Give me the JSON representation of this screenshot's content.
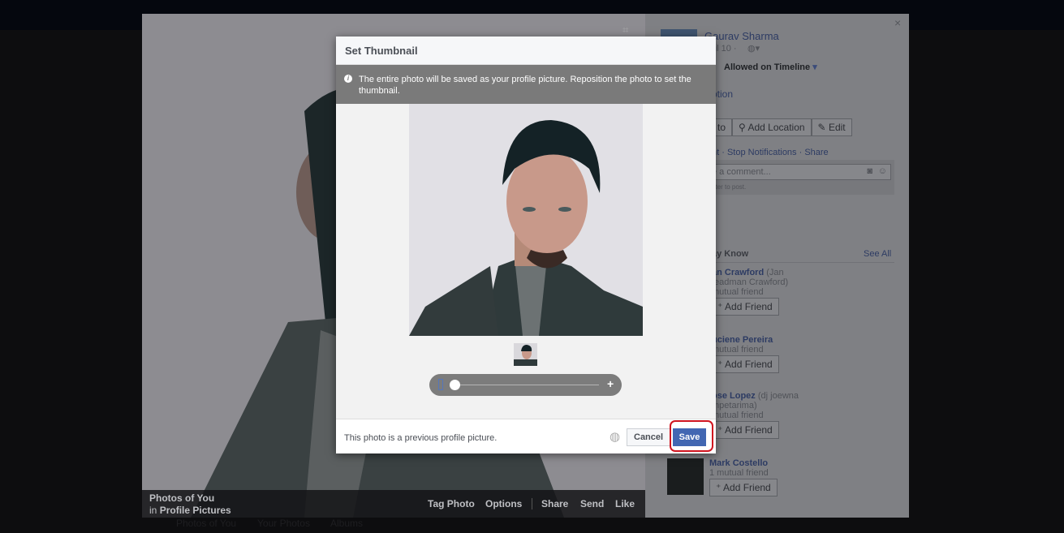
{
  "lightbox": {
    "photo_bar": {
      "album_title": "Photos of You",
      "in_label": "in",
      "album_name": "Profile Pictures",
      "actions": [
        "Tag Photo",
        "Options",
        "Share",
        "Send",
        "Like"
      ]
    },
    "side": {
      "author": "Gaurav Sharma",
      "date": "ril 10 ·",
      "privacy": "Allowed on Timeline",
      "caption_link": "ption",
      "buttons": [
        "to",
        "Add Location",
        "Edit"
      ],
      "actions": "nt · Stop Notifications · Share",
      "comment_placeholder": "e a comment...",
      "comment_hint": "nter to post.",
      "pymk_title": "ay Know",
      "see_all": "See All",
      "people": [
        {
          "name": "an Crawford",
          "alt": "(Jan",
          "alt2": "teadman Crawford)",
          "mutual": "mutual friend",
          "button": "Add Friend"
        },
        {
          "name": "uciene Pereira",
          "mutual": "mutual friend",
          "button": "Add Friend"
        },
        {
          "name": "ose Lopez",
          "alt": "(dj joewna",
          "alt2": "mpetarima)",
          "mutual": "mutual friend",
          "button": "Add Friend"
        },
        {
          "name": "Mark Costello",
          "mutual": "1 mutual friend",
          "button": "Add Friend"
        }
      ]
    }
  },
  "bottom_tabs": [
    "Photos of You",
    "Your Photos",
    "Albums"
  ],
  "dialog": {
    "title": "Set Thumbnail",
    "info": "The entire photo will be saved as your profile picture. Reposition the photo to set the thumbnail.",
    "zoom_level": 0.05,
    "footer_text": "This photo is a previous profile picture.",
    "cancel": "Cancel",
    "save": "Save",
    "save_color": "#4267b2",
    "highlight_color": "#d0141f"
  }
}
